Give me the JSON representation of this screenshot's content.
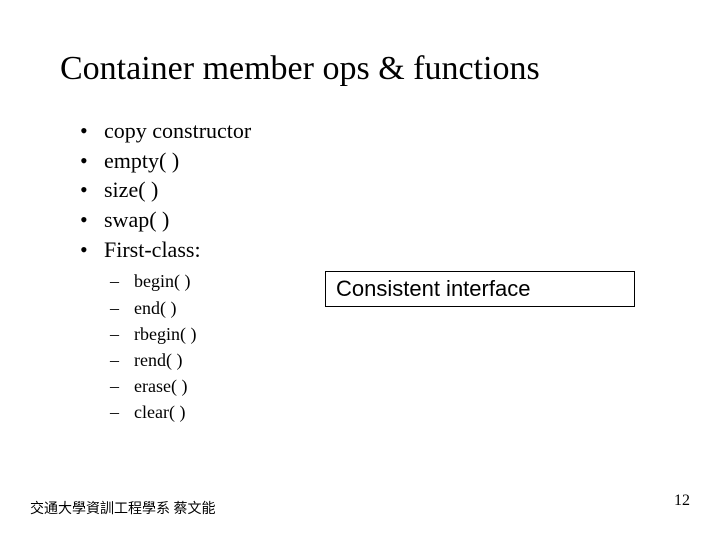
{
  "title": "Container member ops & functions",
  "bullets": {
    "b0": "copy constructor",
    "b1": "empty( )",
    "b2": "size( )",
    "b3": "swap( )",
    "b4": "First-class:"
  },
  "subs": {
    "s0": "begin( )",
    "s1": "end( )",
    "s2": "rbegin( )",
    "s3": "rend( )",
    "s4": "erase( )",
    "s5": "clear( )"
  },
  "callout": "Consistent interface",
  "footer": {
    "left": "交通大學資訓工程學系 蔡文能",
    "page": "12"
  }
}
